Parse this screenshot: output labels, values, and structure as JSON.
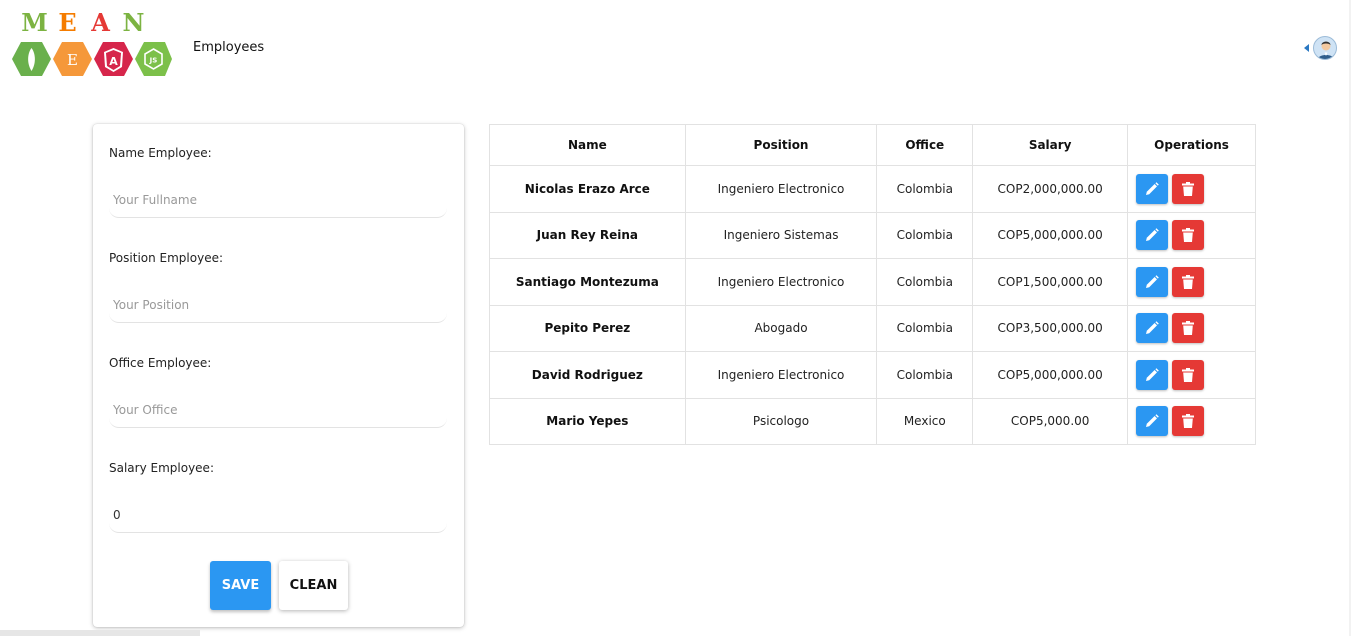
{
  "logo": {
    "letters": [
      "M",
      "E",
      "A",
      "N"
    ],
    "letter_colors": [
      "#7cb342",
      "#f57c00",
      "#e53935",
      "#7cb342"
    ],
    "hex_colors": [
      "#6ab04c",
      "#f5983a",
      "#d6264b",
      "#7cc04a"
    ],
    "hex_glyphs": [
      "",
      "E",
      "A",
      "JS"
    ]
  },
  "nav": {
    "title": "Employees"
  },
  "form": {
    "name": {
      "label": "Name Employee:",
      "placeholder": "Your Fullname",
      "value": ""
    },
    "position": {
      "label": "Position Employee:",
      "placeholder": "Your Position",
      "value": ""
    },
    "office": {
      "label": "Office Employee:",
      "placeholder": "Your Office",
      "value": ""
    },
    "salary": {
      "label": "Salary Employee:",
      "placeholder": "",
      "value": "0"
    },
    "save_label": "SAVE",
    "clean_label": "CLEAN"
  },
  "table": {
    "headers": [
      "Name",
      "Position",
      "Office",
      "Salary",
      "Operations"
    ],
    "rows": [
      {
        "name": "Nicolas Erazo Arce",
        "position": "Ingeniero Electronico",
        "office": "Colombia",
        "salary": "COP2,000,000.00"
      },
      {
        "name": "Juan Rey Reina",
        "position": "Ingeniero Sistemas",
        "office": "Colombia",
        "salary": "COP5,000,000.00"
      },
      {
        "name": "Santiago Montezuma",
        "position": "Ingeniero Electronico",
        "office": "Colombia",
        "salary": "COP1,500,000.00"
      },
      {
        "name": "Pepito Perez",
        "position": "Abogado",
        "office": "Colombia",
        "salary": "COP3,500,000.00"
      },
      {
        "name": "David Rodriguez",
        "position": "Ingeniero Electronico",
        "office": "Colombia",
        "salary": "COP5,000,000.00"
      },
      {
        "name": "Mario Yepes",
        "position": "Psicologo",
        "office": "Mexico",
        "salary": "COP5,000.00"
      }
    ]
  },
  "colors": {
    "primary": "#2b97f2",
    "danger": "#e53935"
  }
}
